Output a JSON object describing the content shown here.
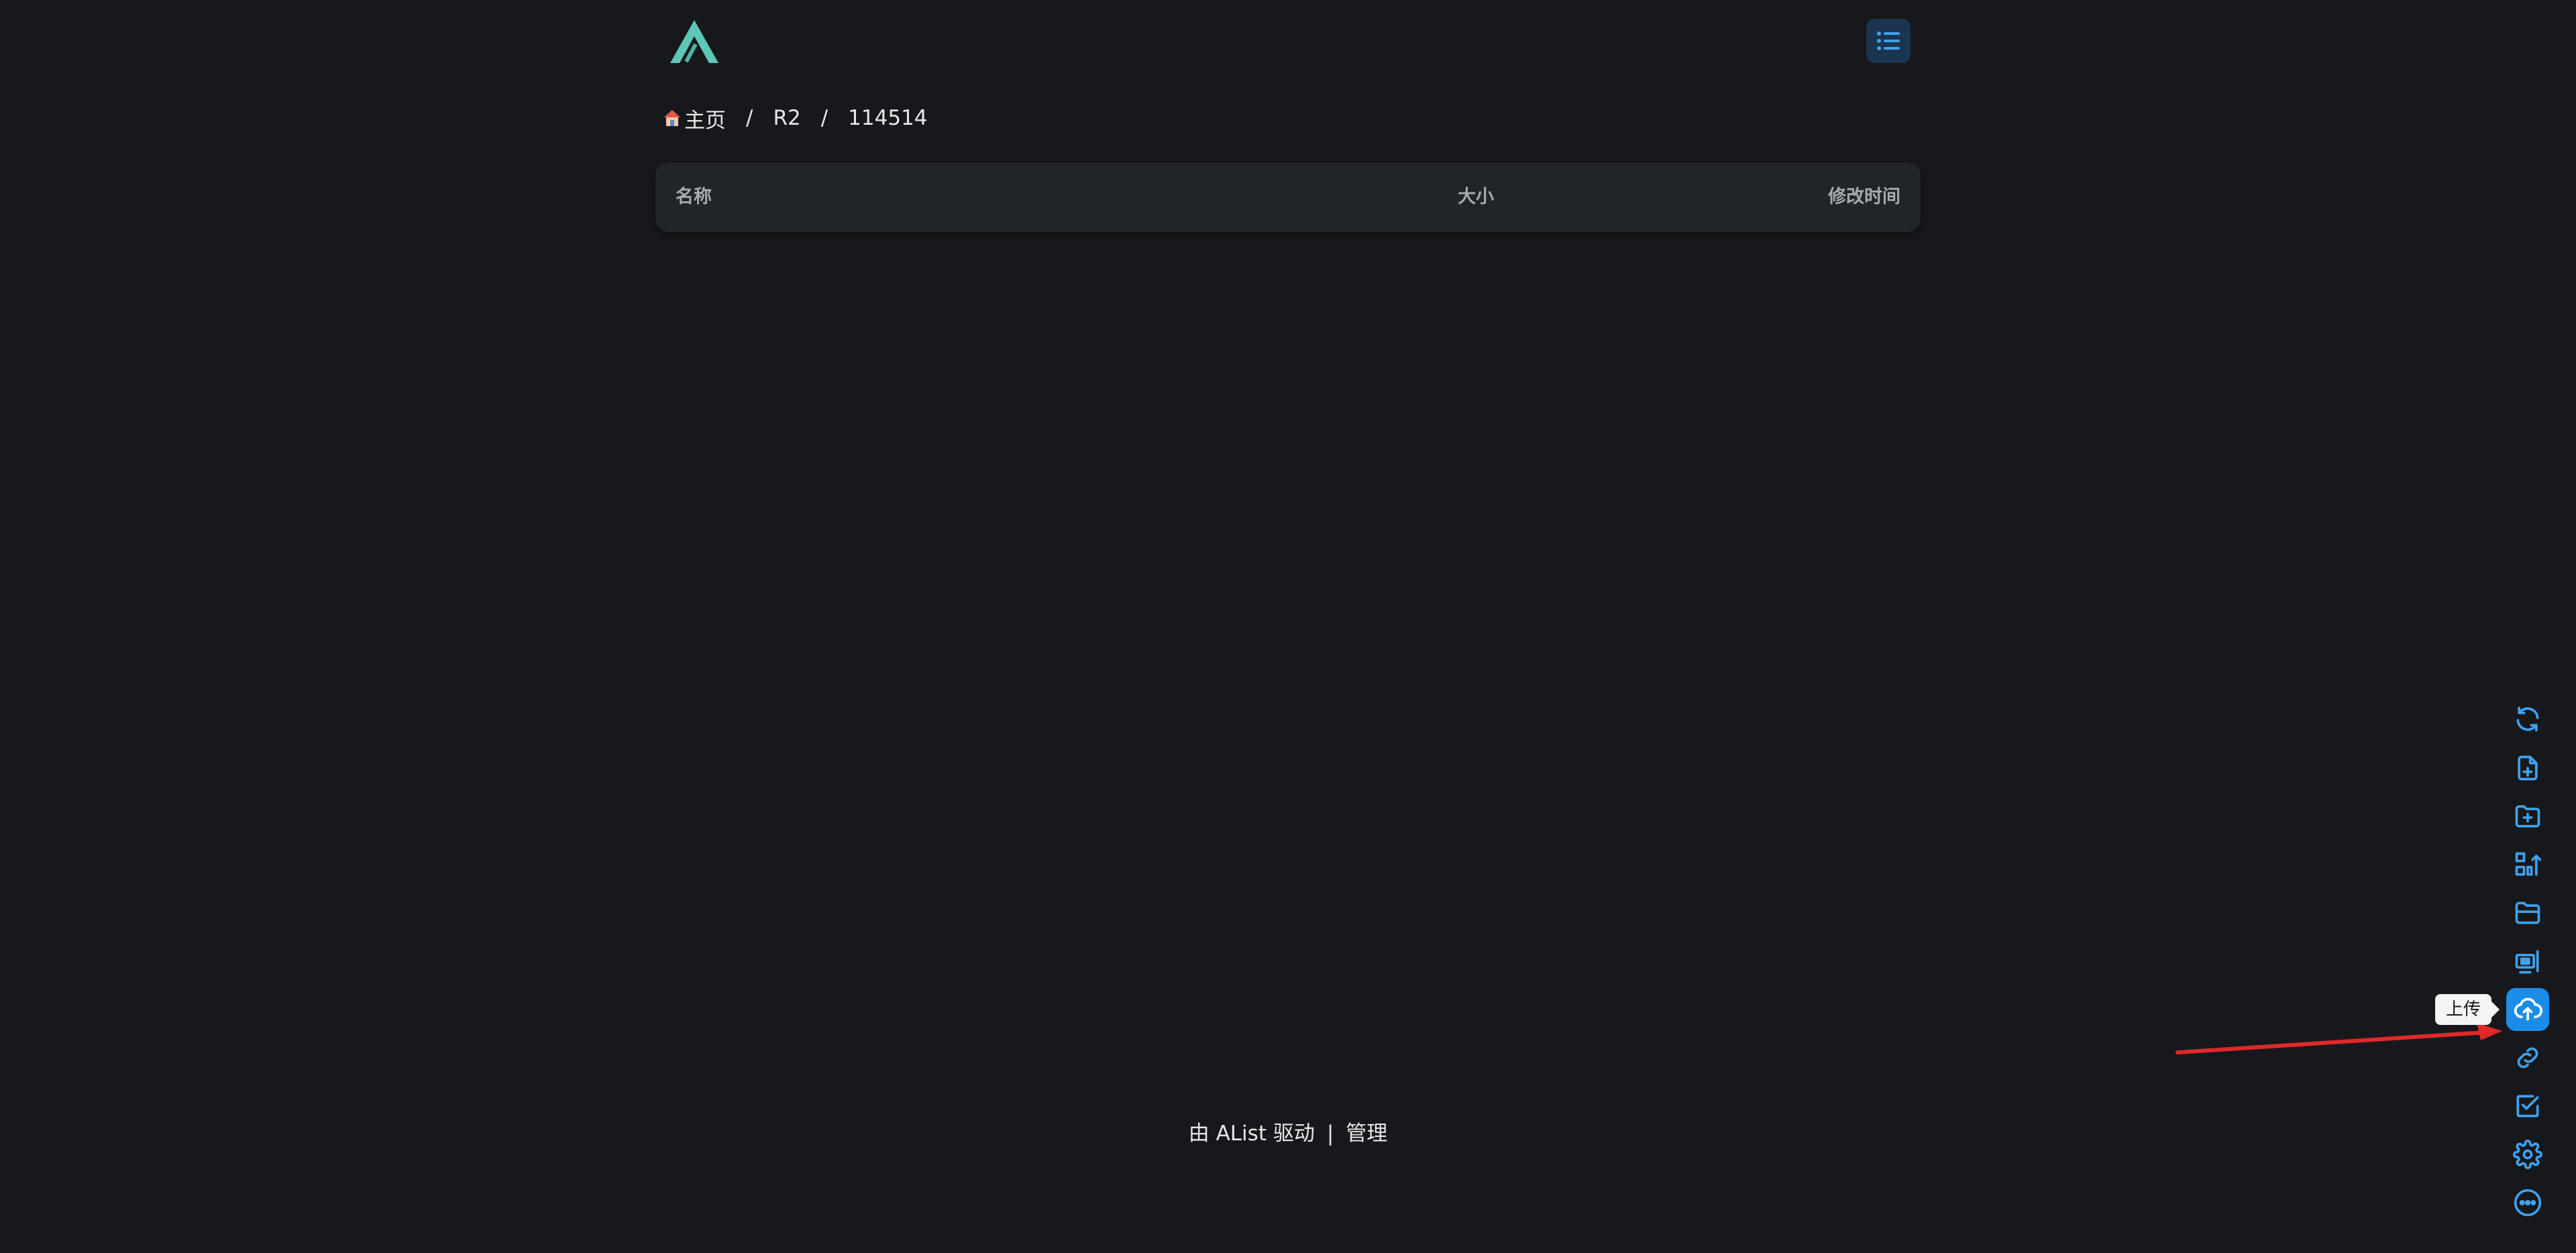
{
  "header": {
    "logo_icon": "alist-logo-icon",
    "layout_toggle_icon": "list-view-icon"
  },
  "breadcrumb": {
    "home_icon": "home-icon",
    "items": [
      "主页",
      "R2",
      "114514"
    ],
    "separator": "/"
  },
  "file_table": {
    "columns": {
      "name": "名称",
      "size": "大小",
      "modified": "修改时间"
    },
    "rows": []
  },
  "footer": {
    "powered_by": "由 AList 驱动",
    "separator": "|",
    "manage": "管理"
  },
  "toolbar": {
    "items": [
      {
        "icon": "refresh-icon"
      },
      {
        "icon": "new-file-icon"
      },
      {
        "icon": "new-folder-icon"
      },
      {
        "icon": "batch-upload-icon"
      },
      {
        "icon": "folder-icon"
      },
      {
        "icon": "offline-download-icon"
      },
      {
        "icon": "upload-cloud-icon"
      },
      {
        "icon": "link-icon"
      },
      {
        "icon": "check-box-icon"
      },
      {
        "icon": "gear-icon"
      },
      {
        "icon": "more-icon"
      }
    ],
    "active_tooltip": "上传"
  },
  "colors": {
    "accent": "#1b8de8",
    "background": "#17181b",
    "table_bg": "#222527",
    "logo": "#5fc7b8",
    "annotation": "#e0282a"
  }
}
